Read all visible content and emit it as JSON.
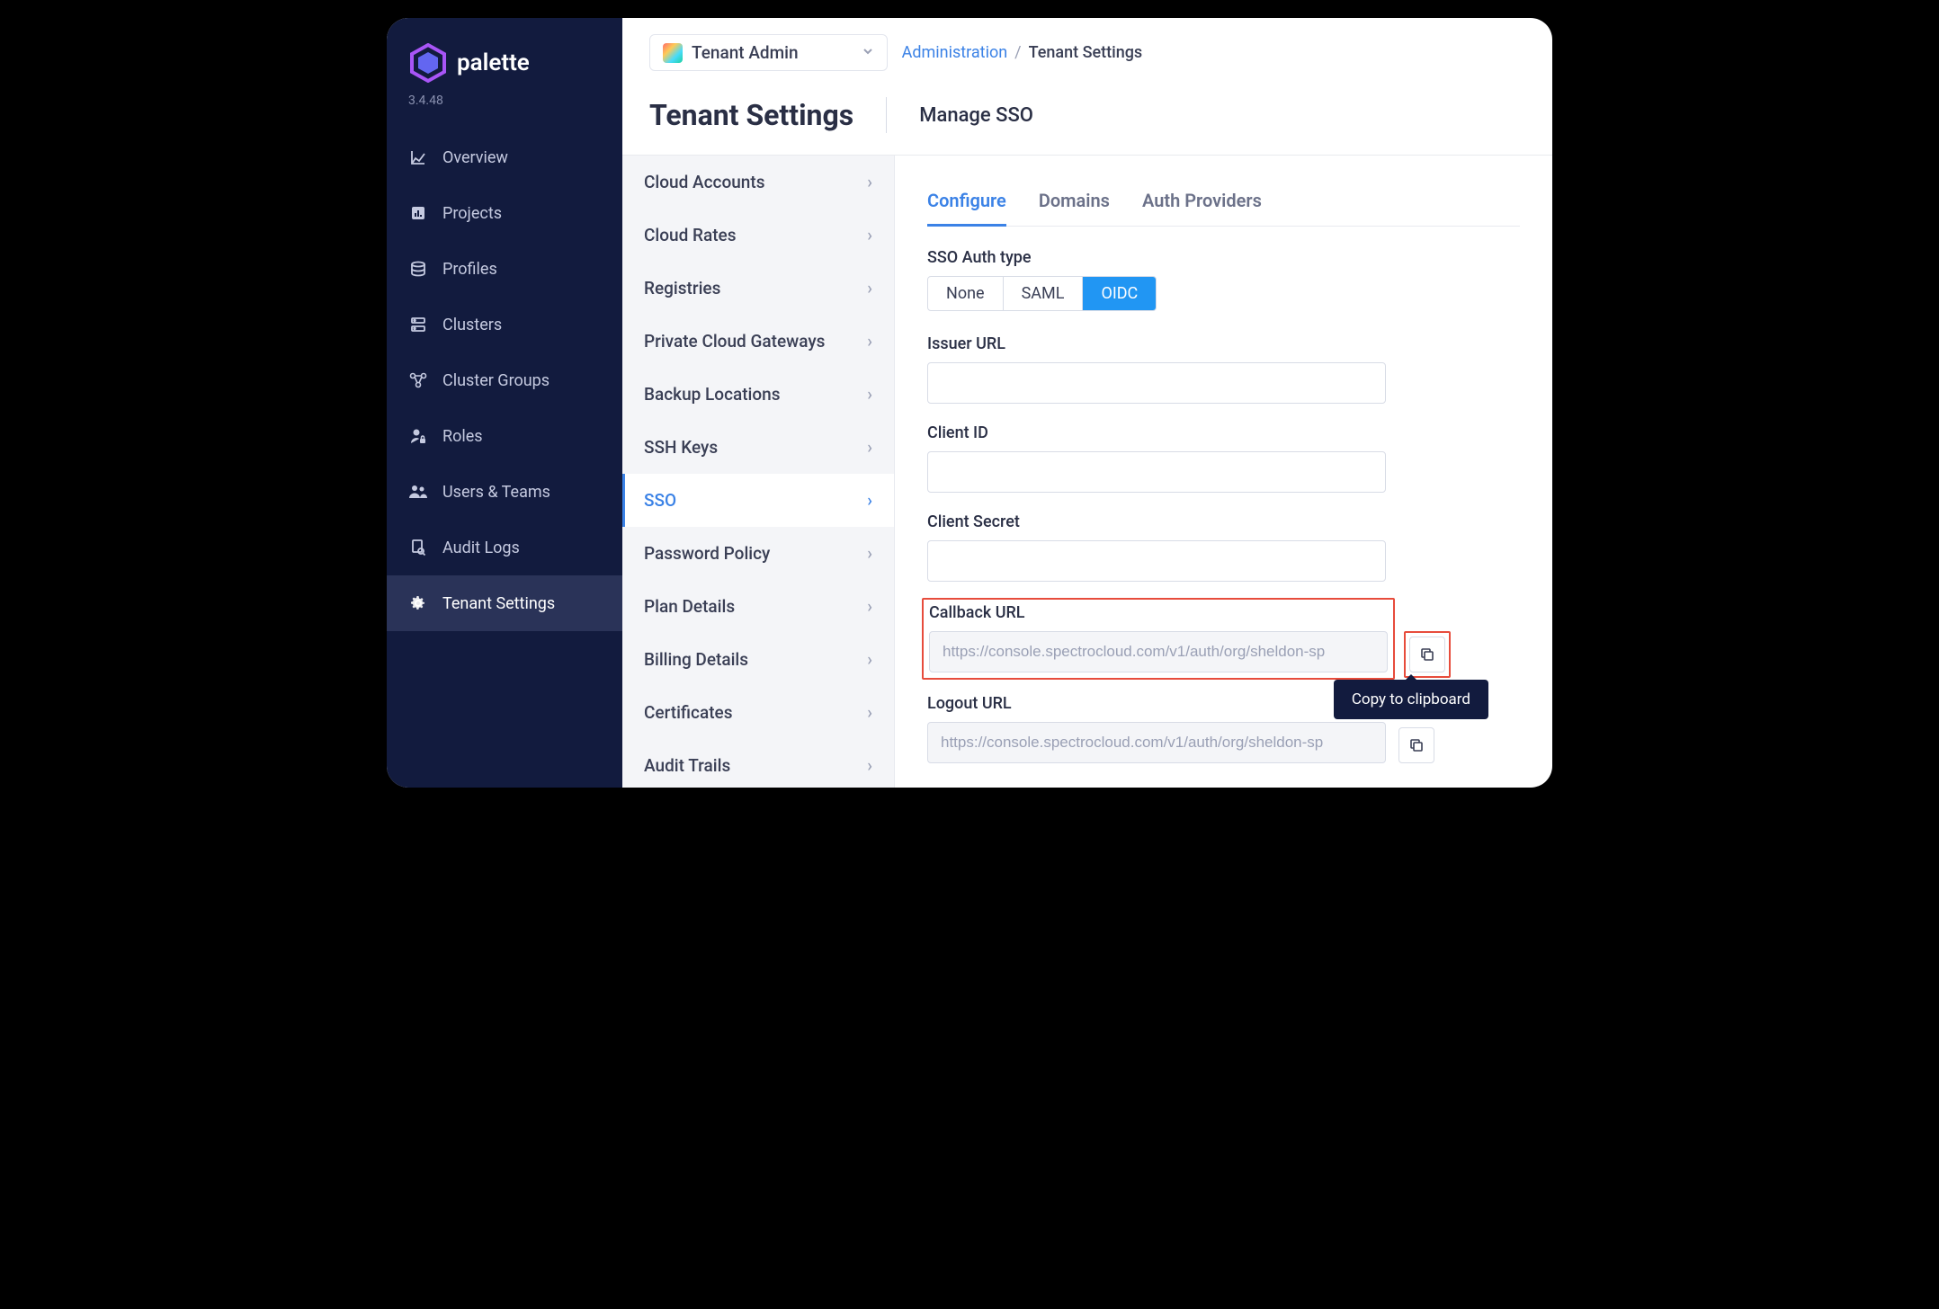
{
  "brand": {
    "name": "palette",
    "version": "3.4.48"
  },
  "sidebar": {
    "items": [
      {
        "label": "Overview"
      },
      {
        "label": "Projects"
      },
      {
        "label": "Profiles"
      },
      {
        "label": "Clusters"
      },
      {
        "label": "Cluster Groups"
      },
      {
        "label": "Roles"
      },
      {
        "label": "Users & Teams"
      },
      {
        "label": "Audit Logs"
      },
      {
        "label": "Tenant Settings"
      }
    ]
  },
  "topbar": {
    "tenant_label": "Tenant Admin",
    "breadcrumb_link": "Administration",
    "breadcrumb_current": "Tenant Settings"
  },
  "header": {
    "title": "Tenant Settings",
    "subtitle": "Manage SSO"
  },
  "settings_nav": [
    "Cloud Accounts",
    "Cloud Rates",
    "Registries",
    "Private Cloud Gateways",
    "Backup Locations",
    "SSH Keys",
    "SSO",
    "Password Policy",
    "Plan Details",
    "Billing Details",
    "Certificates",
    "Audit Trails"
  ],
  "tabs": [
    "Configure",
    "Domains",
    "Auth Providers"
  ],
  "sso": {
    "auth_type_label": "SSO Auth type",
    "auth_types": [
      "None",
      "SAML",
      "OIDC"
    ],
    "issuer_label": "Issuer URL",
    "issuer_value": "",
    "client_id_label": "Client ID",
    "client_id_value": "",
    "client_secret_label": "Client Secret",
    "client_secret_value": "",
    "callback_label": "Callback URL",
    "callback_value": "https://console.spectrocloud.com/v1/auth/org/sheldon-sp",
    "logout_label": "Logout URL",
    "logout_value": "https://console.spectrocloud.com/v1/auth/org/sheldon-sp"
  },
  "tooltip": "Copy to clipboard"
}
